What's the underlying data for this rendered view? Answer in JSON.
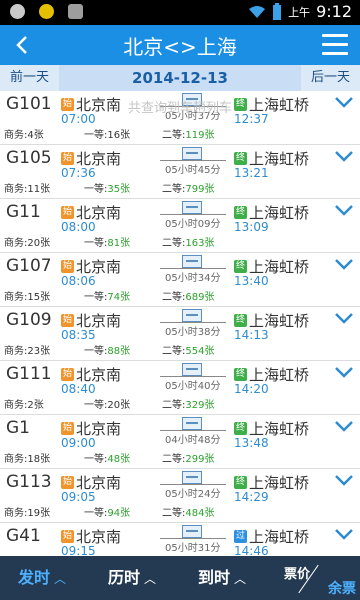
{
  "status_bar": {
    "ampm": "上午",
    "time": "9:12"
  },
  "header": {
    "title": "北京<>上海"
  },
  "date_bar": {
    "prev_label": "前一天",
    "current_date": "2014-12-13",
    "next_label": "后一天"
  },
  "overlay_tip": "共查询到车趟列车",
  "trains": [
    {
      "no": "G101",
      "from_badge": "始",
      "from": "北京南",
      "dep": "07:00",
      "duration": "05小时37分",
      "to_badge": "终",
      "to": "上海虹桥",
      "arr": "12:37",
      "seat1": "商务:4张",
      "seat2_label": "一等:",
      "seat2_val": "16张",
      "seat2_color": "black",
      "seat3_label": "二等:",
      "seat3_val": "119张"
    },
    {
      "no": "G105",
      "from_badge": "始",
      "from": "北京南",
      "dep": "07:36",
      "duration": "05小时45分",
      "to_badge": "终",
      "to": "上海虹桥",
      "arr": "13:21",
      "seat1": "商务:11张",
      "seat2_label": "一等:",
      "seat2_val": "35张",
      "seat2_color": "green",
      "seat3_label": "二等:",
      "seat3_val": "799张"
    },
    {
      "no": "G11",
      "from_badge": "始",
      "from": "北京南",
      "dep": "08:00",
      "duration": "05小时09分",
      "to_badge": "终",
      "to": "上海虹桥",
      "arr": "13:09",
      "seat1": "商务:20张",
      "seat2_label": "一等:",
      "seat2_val": "81张",
      "seat2_color": "green",
      "seat3_label": "二等:",
      "seat3_val": "163张"
    },
    {
      "no": "G107",
      "from_badge": "始",
      "from": "北京南",
      "dep": "08:06",
      "duration": "05小时34分",
      "to_badge": "终",
      "to": "上海虹桥",
      "arr": "13:40",
      "seat1": "商务:15张",
      "seat2_label": "一等:",
      "seat2_val": "74张",
      "seat2_color": "green",
      "seat3_label": "二等:",
      "seat3_val": "689张"
    },
    {
      "no": "G109",
      "from_badge": "始",
      "from": "北京南",
      "dep": "08:35",
      "duration": "05小时38分",
      "to_badge": "终",
      "to": "上海虹桥",
      "arr": "14:13",
      "seat1": "商务:23张",
      "seat2_label": "一等:",
      "seat2_val": "88张",
      "seat2_color": "green",
      "seat3_label": "二等:",
      "seat3_val": "554张"
    },
    {
      "no": "G111",
      "from_badge": "始",
      "from": "北京南",
      "dep": "08:40",
      "duration": "05小时40分",
      "to_badge": "终",
      "to": "上海虹桥",
      "arr": "14:20",
      "seat1": "商务:2张",
      "seat2_label": "一等:",
      "seat2_val": "20张",
      "seat2_color": "black",
      "seat3_label": "二等:",
      "seat3_val": "329张"
    },
    {
      "no": "G1",
      "from_badge": "始",
      "from": "北京南",
      "dep": "09:00",
      "duration": "04小时48分",
      "to_badge": "终",
      "to": "上海虹桥",
      "arr": "13:48",
      "seat1": "商务:18张",
      "seat2_label": "一等:",
      "seat2_val": "48张",
      "seat2_color": "green",
      "seat3_label": "二等:",
      "seat3_val": "299张"
    },
    {
      "no": "G113",
      "from_badge": "始",
      "from": "北京南",
      "dep": "09:05",
      "duration": "05小时24分",
      "to_badge": "终",
      "to": "上海虹桥",
      "arr": "14:29",
      "seat1": "商务:19张",
      "seat2_label": "一等:",
      "seat2_val": "94张",
      "seat2_color": "green",
      "seat3_label": "二等:",
      "seat3_val": "484张"
    },
    {
      "no": "G41",
      "from_badge": "始",
      "from": "北京南",
      "dep": "09:15",
      "duration": "05小时31分",
      "to_badge": "过",
      "to": "上海虹桥",
      "arr": "14:46",
      "seat1": "",
      "seat2_label": "",
      "seat2_val": "",
      "seat2_color": "black",
      "seat3_label": "",
      "seat3_val": ""
    }
  ],
  "bottom_bar": {
    "sort_departure": "发时",
    "sort_duration": "历时",
    "sort_arrival": "到时",
    "price_label": "票价",
    "remaining_label": "余票"
  },
  "colors": {
    "accent": "#1a8fe3",
    "seat_green": "#2aa12a",
    "time_blue": "#2e8ccf",
    "bottom_bg": "#243a52"
  }
}
